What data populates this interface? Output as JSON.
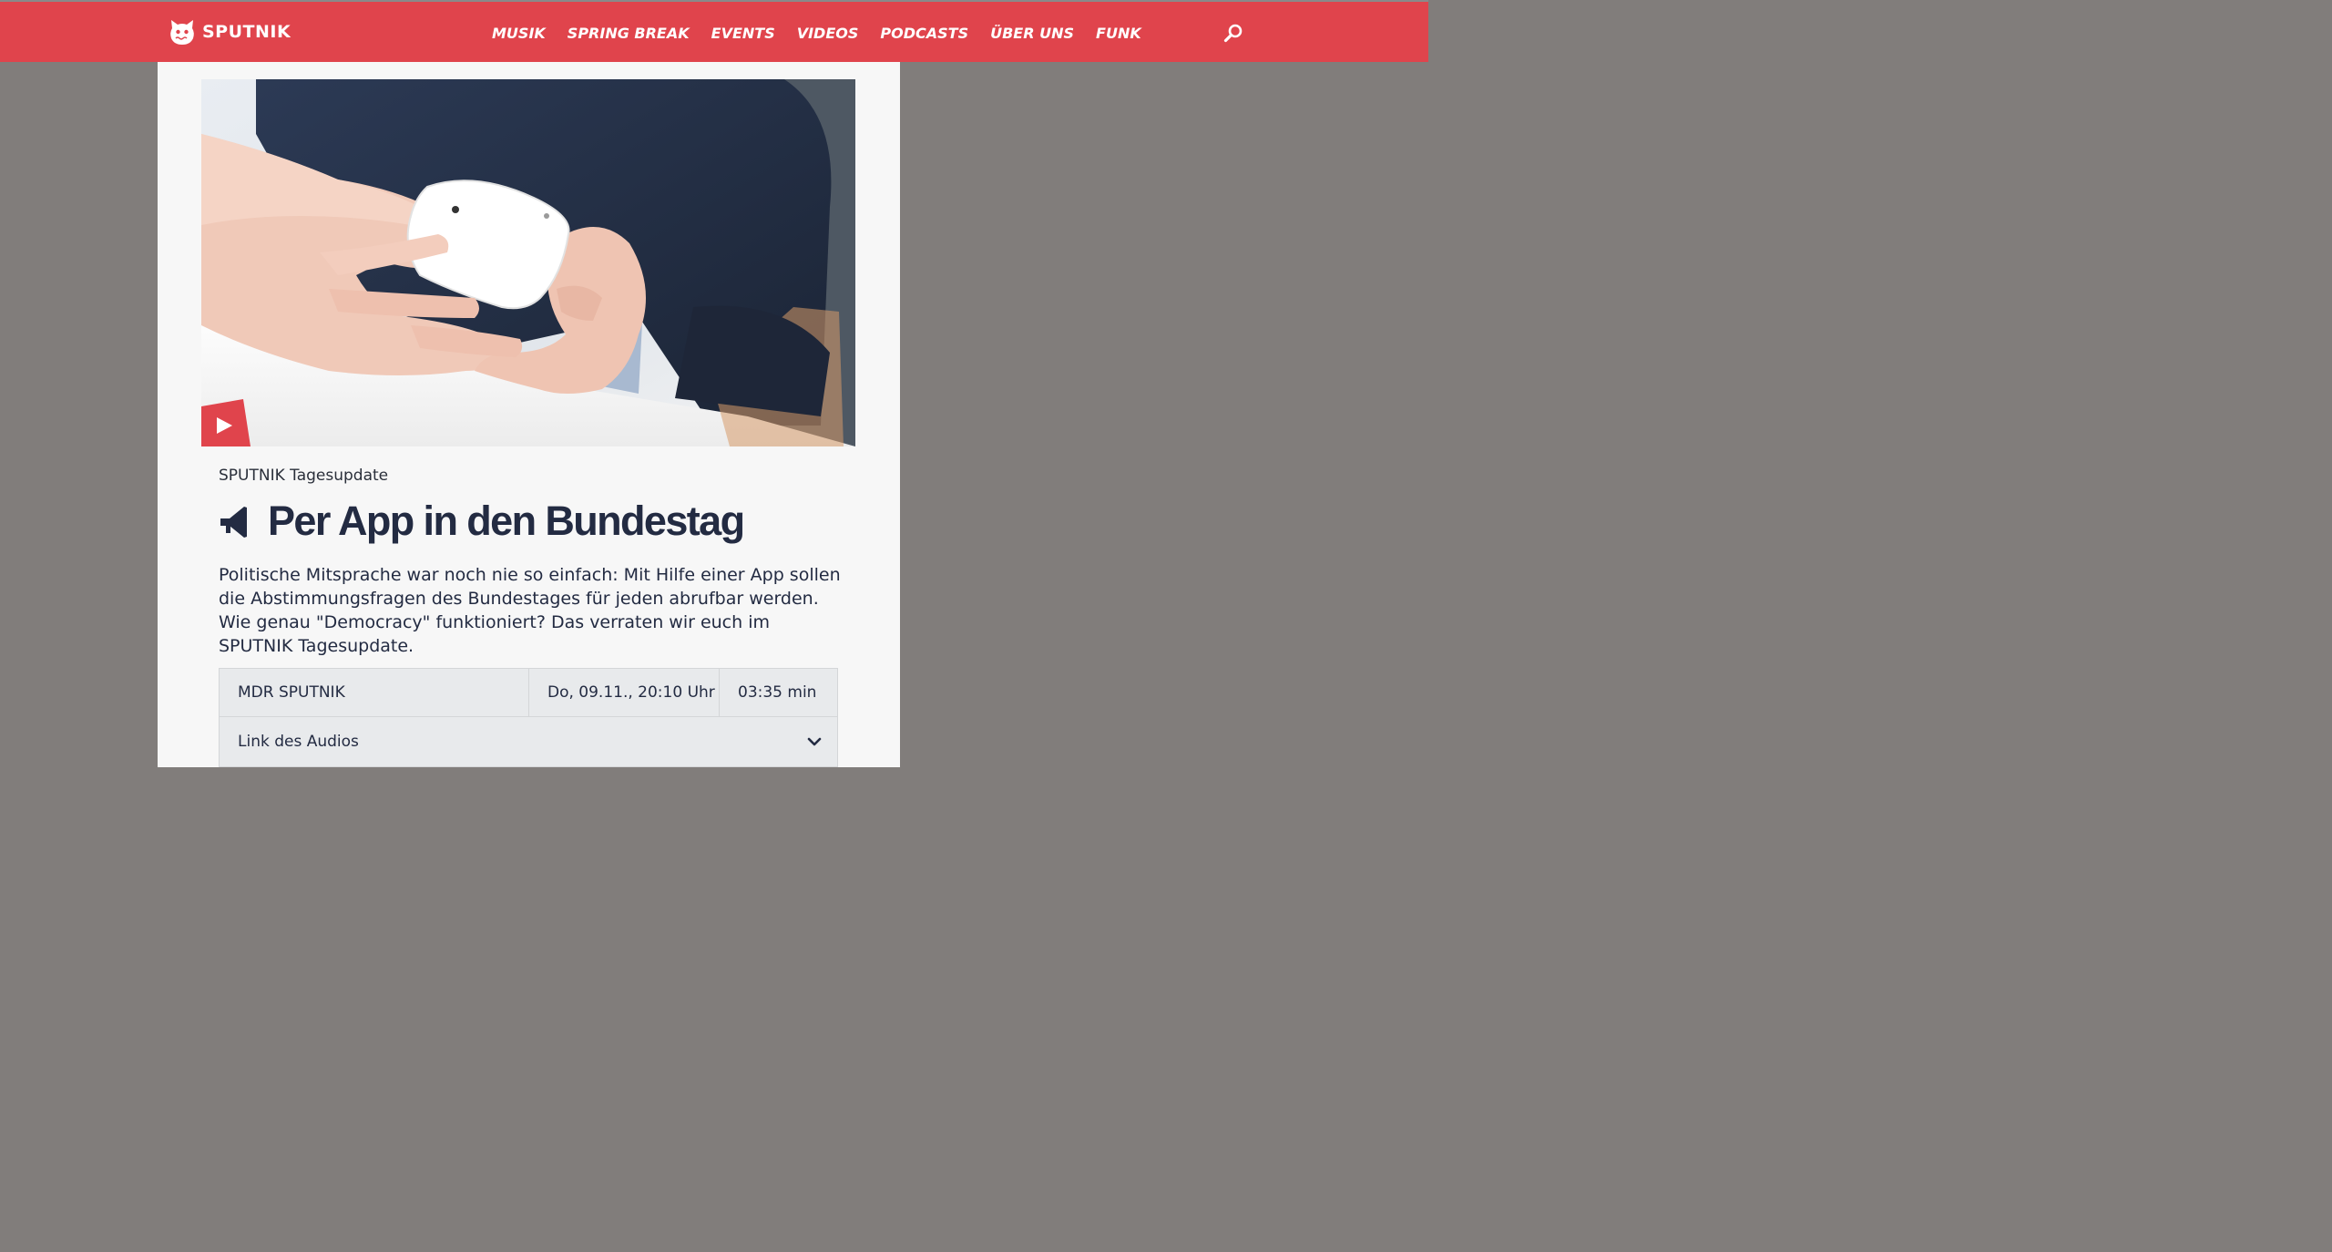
{
  "header": {
    "brand": "SPUTNIK",
    "nav": [
      "MUSIK",
      "SPRING BREAK",
      "EVENTS",
      "VIDEOS",
      "PODCASTS",
      "ÜBER UNS",
      "FUNK"
    ],
    "search_icon": "search-icon",
    "accent_color": "#e0444c"
  },
  "article": {
    "kicker": "SPUTNIK Tagesupdate",
    "title": "Per App in den Bundestag",
    "title_icon": "speaker-icon",
    "teaser": "Politische Mitsprache war noch nie so einfach: Mit Hilfe einer App sollen die Abstimmungsfragen des Bundestages für jeden abrufbar werden. Wie genau \"Democracy\" funktioniert? Das verraten wir euch im SPUTNIK Tagesupdate.",
    "play_icon": "play-icon"
  },
  "audio_meta": {
    "station": "MDR SPUTNIK",
    "date": "Do, 09.11., 20:10 Uhr",
    "duration": "03:35 min",
    "link_label": "Link des Audios",
    "expand_icon": "chevron-down-icon"
  },
  "colors": {
    "page_background": "#817d7b",
    "headline": "#232b42"
  }
}
